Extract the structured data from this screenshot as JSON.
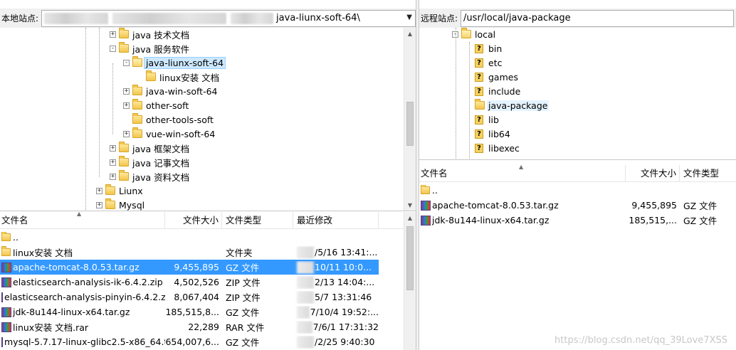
{
  "local": {
    "site_label": "本地站点:",
    "path_suffix": "java-liunx-soft-64\\",
    "tree": [
      {
        "label": "java 技术文档",
        "indent": 2,
        "expander": "+",
        "icon": "folder",
        "state": ""
      },
      {
        "label": "java 服务软件",
        "indent": 2,
        "expander": "-",
        "icon": "folder",
        "state": ""
      },
      {
        "label": "java-liunx-soft-64",
        "indent": 3,
        "expander": "-",
        "icon": "folder-open",
        "state": "sel"
      },
      {
        "label": "linux安装 文档",
        "indent": 4,
        "expander": "",
        "icon": "folder",
        "state": ""
      },
      {
        "label": "java-win-soft-64",
        "indent": 3,
        "expander": "+",
        "icon": "folder",
        "state": ""
      },
      {
        "label": "other-soft",
        "indent": 3,
        "expander": "+",
        "icon": "folder",
        "state": ""
      },
      {
        "label": "other-tools-soft",
        "indent": 3,
        "expander": "",
        "icon": "folder",
        "state": ""
      },
      {
        "label": "vue-win-soft-64",
        "indent": 3,
        "expander": "+",
        "icon": "folder",
        "state": ""
      },
      {
        "label": "java 框架文档",
        "indent": 2,
        "expander": "+",
        "icon": "folder",
        "state": ""
      },
      {
        "label": "java 记事文档",
        "indent": 2,
        "expander": "+",
        "icon": "folder",
        "state": ""
      },
      {
        "label": "java 资料文档",
        "indent": 2,
        "expander": "+",
        "icon": "folder",
        "state": ""
      },
      {
        "label": "Liunx",
        "indent": 1,
        "expander": "+",
        "icon": "folder",
        "state": ""
      },
      {
        "label": "Mysql",
        "indent": 1,
        "expander": "+",
        "icon": "folder",
        "state": ""
      }
    ],
    "columns": {
      "name": "文件名",
      "size": "文件大小",
      "type": "文件类型",
      "modified": "最近修改"
    },
    "files": [
      {
        "name": "..",
        "size": "",
        "type": "",
        "modified": "",
        "icon": "folder",
        "selected": false
      },
      {
        "name": "linux安装 文档",
        "size": "",
        "type": "文件夹",
        "modified": "/5/16 13:41:...",
        "icon": "folder",
        "selected": false
      },
      {
        "name": "apache-tomcat-8.0.53.tar.gz",
        "size": "9,455,895",
        "type": "GZ 文件",
        "modified": "10/11 10:0...",
        "icon": "archive",
        "selected": true
      },
      {
        "name": "elasticsearch-analysis-ik-6.4.2.zip",
        "size": "4,502,526",
        "type": "ZIP 文件",
        "modified": "2/13 14:04:...",
        "icon": "archive",
        "selected": false
      },
      {
        "name": "elasticsearch-analysis-pinyin-6.4.2.z...",
        "size": "8,067,404",
        "type": "ZIP 文件",
        "modified": "5/7 13:31:46",
        "icon": "archive",
        "selected": false
      },
      {
        "name": "jdk-8u144-linux-x64.tar.gz",
        "size": "185,515,8...",
        "type": "GZ 文件",
        "modified": "7/10/4 19:52:...",
        "icon": "archive",
        "selected": false
      },
      {
        "name": "linux安装 文档.rar",
        "size": "22,289",
        "type": "RAR 文件",
        "modified": "7/6/1 17:31:32",
        "icon": "archive",
        "selected": false
      },
      {
        "name": "mysql-5.7.17-linux-glibc2.5-x86_64.t...",
        "size": "654,007,6...",
        "type": "GZ 文件",
        "modified": "/2/25 9:40:30",
        "icon": "archive",
        "selected": false
      }
    ]
  },
  "remote": {
    "site_label": "远程站点:",
    "path": "/usr/local/java-package",
    "tree": [
      {
        "label": "local",
        "indent": 2,
        "expander": "-",
        "icon": "folder-open",
        "state": ""
      },
      {
        "label": "bin",
        "indent": 3,
        "expander": "",
        "icon": "question",
        "state": ""
      },
      {
        "label": "etc",
        "indent": 3,
        "expander": "",
        "icon": "question",
        "state": ""
      },
      {
        "label": "games",
        "indent": 3,
        "expander": "",
        "icon": "question",
        "state": ""
      },
      {
        "label": "include",
        "indent": 3,
        "expander": "",
        "icon": "question",
        "state": ""
      },
      {
        "label": "java-package",
        "indent": 3,
        "expander": "",
        "icon": "folder",
        "state": "hl"
      },
      {
        "label": "lib",
        "indent": 3,
        "expander": "",
        "icon": "question",
        "state": ""
      },
      {
        "label": "lib64",
        "indent": 3,
        "expander": "",
        "icon": "question",
        "state": ""
      },
      {
        "label": "libexec",
        "indent": 3,
        "expander": "",
        "icon": "question",
        "state": ""
      }
    ],
    "columns": {
      "name": "文件名",
      "size": "文件大小",
      "type": "文件类型"
    },
    "files": [
      {
        "name": "..",
        "size": "",
        "type": "",
        "icon": "folder"
      },
      {
        "name": "apache-tomcat-8.0.53.tar.gz",
        "size": "9,455,895",
        "type": "GZ 文件",
        "icon": "archive"
      },
      {
        "name": "jdk-8u144-linux-x64.tar.gz",
        "size": "185,515,...",
        "type": "GZ 文件",
        "icon": "archive"
      }
    ]
  },
  "watermark": "https://blog.csdn.net/qq_39Love7XSS"
}
